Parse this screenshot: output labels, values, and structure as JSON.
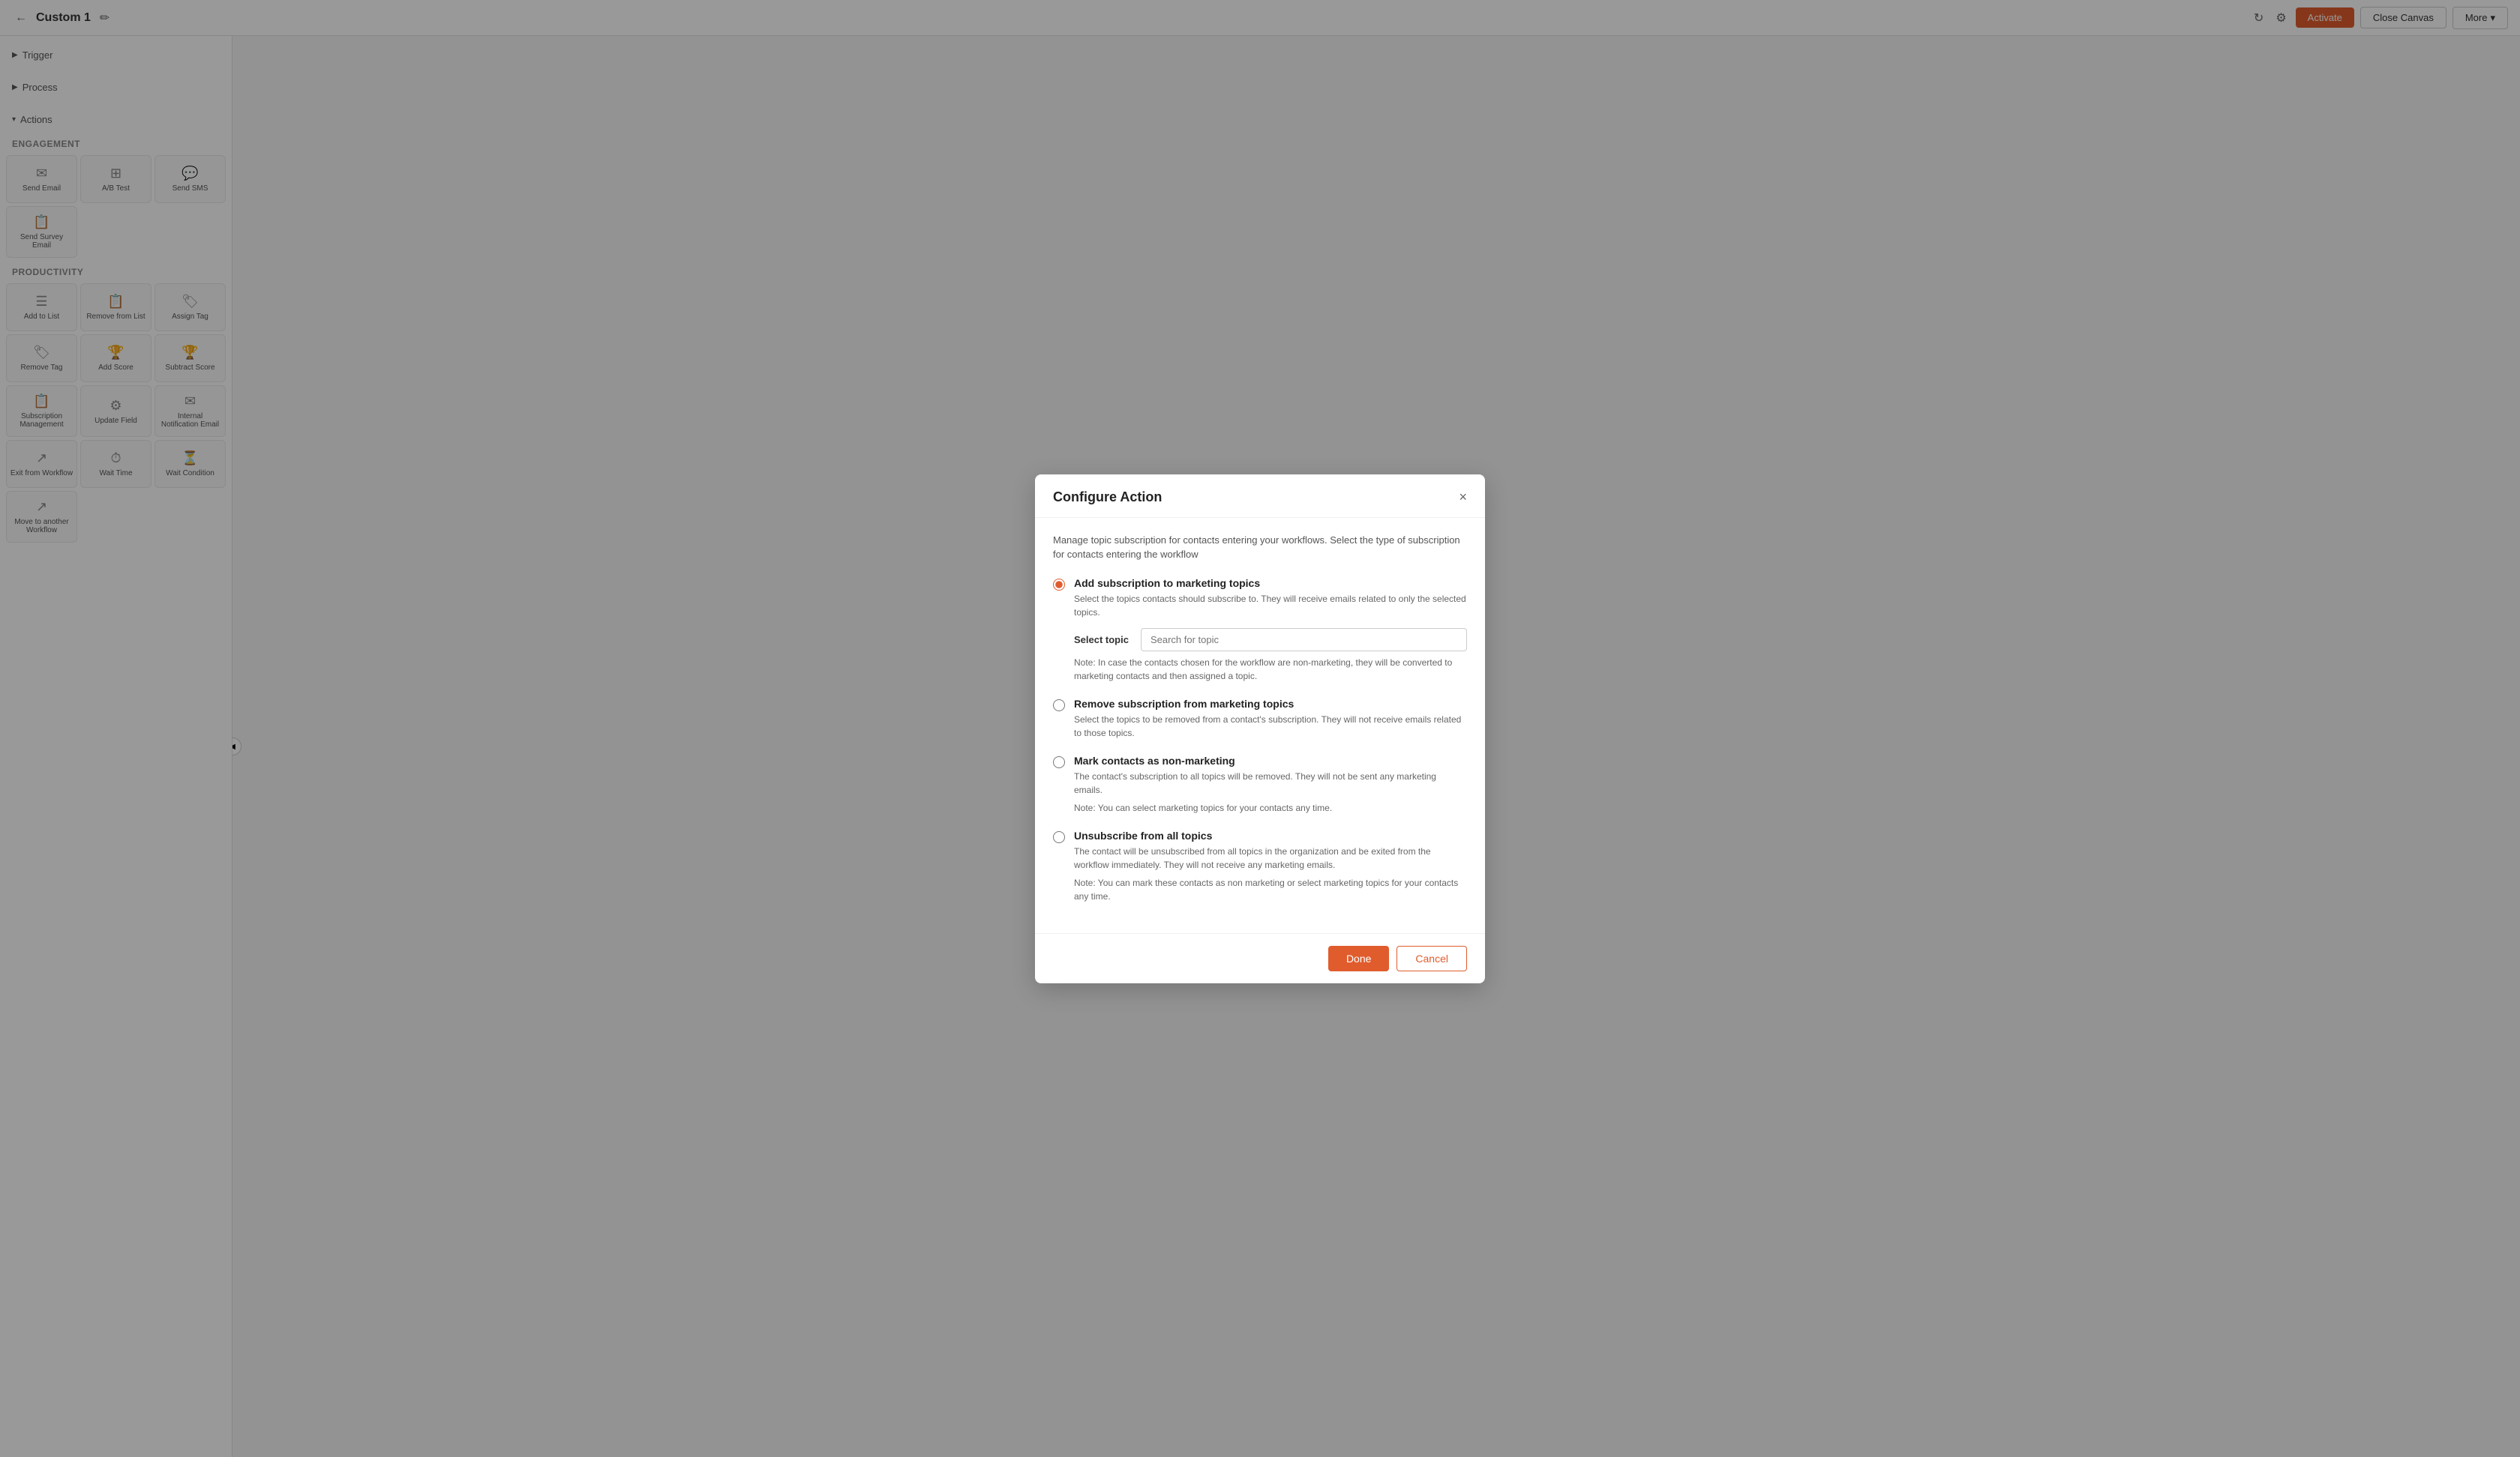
{
  "topbar": {
    "back_icon": "←",
    "title": "Custom 1",
    "edit_icon": "✏",
    "refresh_icon": "↻",
    "settings_icon": "⚙",
    "activate_label": "Activate",
    "close_canvas_label": "Close Canvas",
    "more_label": "More",
    "chevron_down": "▾"
  },
  "sidebar": {
    "trigger_label": "Trigger",
    "process_label": "Process",
    "actions_label": "Actions",
    "engagement_section": "Engagement",
    "productivity_section": "Productivity",
    "engagement_items": [
      {
        "label": "Send Email",
        "icon": "✉"
      },
      {
        "label": "A/B Test",
        "icon": "⊞"
      },
      {
        "label": "Send SMS",
        "icon": "💬"
      },
      {
        "label": "Send Survey Email",
        "icon": "📋"
      }
    ],
    "productivity_items": [
      {
        "label": "Add to List",
        "icon": "☰"
      },
      {
        "label": "Remove from List",
        "icon": "📋"
      },
      {
        "label": "Assign Tag",
        "icon": "🏷"
      },
      {
        "label": "Remove Tag",
        "icon": "🏷"
      },
      {
        "label": "Add Score",
        "icon": "🏆"
      },
      {
        "label": "Subtract Score",
        "icon": "🏆"
      },
      {
        "label": "Subscription Management",
        "icon": "📋"
      },
      {
        "label": "Update Field",
        "icon": "⚙"
      },
      {
        "label": "Internal Notification Email",
        "icon": "✉"
      },
      {
        "label": "Exit from Workflow",
        "icon": "↗"
      },
      {
        "label": "Wait Time",
        "icon": "⏱"
      },
      {
        "label": "Wait Condition",
        "icon": "⏳"
      },
      {
        "label": "Move to another Workflow",
        "icon": "↗"
      }
    ]
  },
  "modal": {
    "title": "Configure Action",
    "close_icon": "×",
    "description": "Manage topic subscription for contacts entering your workflows. Select the type of subscription for contacts entering the workflow",
    "options": [
      {
        "id": "opt1",
        "label": "Add subscription to marketing topics",
        "checked": true,
        "desc": "Select the topics contacts should subscribe to. They will receive emails related to only the selected topics.",
        "note": "Note: In case the contacts chosen for the workflow are non-marketing, they will be converted to marketing contacts and then assigned a topic.",
        "has_topic_selector": true
      },
      {
        "id": "opt2",
        "label": "Remove subscription from marketing topics",
        "checked": false,
        "desc": "Select the topics to be removed from a contact's subscription. They will not receive emails related to those topics.",
        "note": null,
        "has_topic_selector": false
      },
      {
        "id": "opt3",
        "label": "Mark contacts as non-marketing",
        "checked": false,
        "desc": "The contact's subscription to all topics will be removed. They will not be sent any marketing emails.",
        "note": "Note: You can select marketing topics for your contacts any time.",
        "has_topic_selector": false
      },
      {
        "id": "opt4",
        "label": "Unsubscribe from all topics",
        "checked": false,
        "desc": "The contact will be unsubscribed from all topics in the organization and be exited from the workflow immediately. They will not receive any marketing emails.",
        "note": "Note: You can mark these contacts as non marketing or select marketing topics for your contacts any time.",
        "has_topic_selector": false
      }
    ],
    "select_topic_label": "Select topic",
    "select_topic_placeholder": "Search for topic",
    "done_label": "Done",
    "cancel_label": "Cancel"
  }
}
